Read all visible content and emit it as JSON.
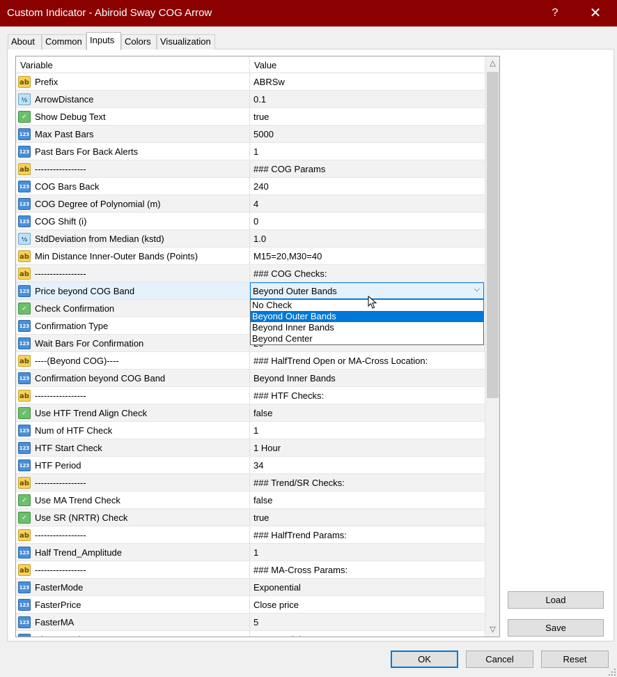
{
  "window": {
    "title": "Custom Indicator - Abiroid Sway COG Arrow",
    "help_glyph": "?",
    "close_glyph": "✕"
  },
  "tabs": [
    {
      "label": "About",
      "active": false
    },
    {
      "label": "Common",
      "active": false
    },
    {
      "label": "Inputs",
      "active": true
    },
    {
      "label": "Colors",
      "active": false
    },
    {
      "label": "Visualization",
      "active": false
    }
  ],
  "grid": {
    "col_variable": "Variable",
    "col_value": "Value",
    "rows": [
      {
        "icon": "ab",
        "name": "Prefix",
        "value": "ABRSw"
      },
      {
        "icon": "half",
        "name": "ArrowDistance",
        "value": "0.1"
      },
      {
        "icon": "bool",
        "name": "Show Debug Text",
        "value": "true"
      },
      {
        "icon": "123",
        "name": "Max Past Bars",
        "value": "5000"
      },
      {
        "icon": "123",
        "name": "Past Bars For Back Alerts",
        "value": "1"
      },
      {
        "icon": "ab",
        "name": "-----------------",
        "value": "### COG Params"
      },
      {
        "icon": "123",
        "name": "COG Bars Back",
        "value": "240"
      },
      {
        "icon": "123",
        "name": "COG Degree of Polynomial (m)",
        "value": "4"
      },
      {
        "icon": "123",
        "name": "COG Shift (i)",
        "value": "0"
      },
      {
        "icon": "half",
        "name": "StdDeviation from Median (kstd)",
        "value": "1.0"
      },
      {
        "icon": "ab",
        "name": "Min Distance Inner-Outer Bands (Points)",
        "value": "M15=20,M30=40"
      },
      {
        "icon": "ab",
        "name": "-----------------",
        "value": "### COG Checks:"
      },
      {
        "icon": "123",
        "name": "Price beyond COG Band",
        "value": ""
      },
      {
        "icon": "bool",
        "name": "Check Confirmation",
        "value": ""
      },
      {
        "icon": "123",
        "name": "Confirmation Type",
        "value": ""
      },
      {
        "icon": "123",
        "name": "Wait Bars For Confirmation",
        "value": "20"
      },
      {
        "icon": "ab",
        "name": "----(Beyond COG)----",
        "value": "### HalfTrend Open or MA-Cross Location:"
      },
      {
        "icon": "123",
        "name": "Confirmation beyond COG Band",
        "value": "Beyond Inner Bands"
      },
      {
        "icon": "ab",
        "name": "-----------------",
        "value": "### HTF Checks:"
      },
      {
        "icon": "bool",
        "name": "Use HTF Trend Align Check",
        "value": "false"
      },
      {
        "icon": "123",
        "name": "Num of HTF Check",
        "value": "1"
      },
      {
        "icon": "123",
        "name": "HTF Start Check",
        "value": "1 Hour"
      },
      {
        "icon": "123",
        "name": "HTF Period",
        "value": "34"
      },
      {
        "icon": "ab",
        "name": "-----------------",
        "value": "### Trend/SR Checks:"
      },
      {
        "icon": "bool",
        "name": "Use MA Trend Check",
        "value": "false"
      },
      {
        "icon": "bool",
        "name": "Use SR (NRTR) Check",
        "value": "true"
      },
      {
        "icon": "ab",
        "name": "-----------------",
        "value": "### HalfTrend Params:"
      },
      {
        "icon": "123",
        "name": "Half Trend_Amplitude",
        "value": "1"
      },
      {
        "icon": "ab",
        "name": "-----------------",
        "value": "### MA-Cross Params:"
      },
      {
        "icon": "123",
        "name": "FasterMode",
        "value": "Exponential"
      },
      {
        "icon": "123",
        "name": "FasterPrice",
        "value": "Close price"
      },
      {
        "icon": "123",
        "name": "FasterMA",
        "value": "5"
      },
      {
        "icon": "123",
        "name": "SlowerMode",
        "value": "Exponential"
      }
    ]
  },
  "combo": {
    "value": "Beyond Outer Bands",
    "chevron": "⌵"
  },
  "dropdown": {
    "options": [
      "No Check",
      "Beyond Outer Bands",
      "Beyond Inner Bands",
      "Beyond Center"
    ],
    "highlighted_index": 1
  },
  "icon_labels": {
    "ab": "ab",
    "123": "123",
    "half": "½",
    "bool": "✓"
  },
  "side_buttons": {
    "load": "Load",
    "save": "Save"
  },
  "buttons": {
    "ok": "OK",
    "cancel": "Cancel",
    "reset": "Reset"
  },
  "colors": {
    "titlebar": "#8b0000",
    "accent": "#0078d7",
    "selection": "#e5f1fb"
  }
}
